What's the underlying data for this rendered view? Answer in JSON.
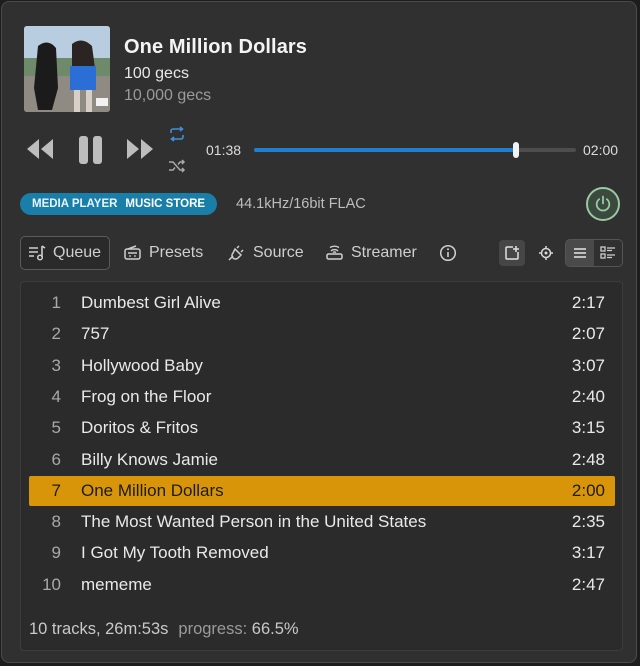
{
  "now_playing": {
    "title": "One Million Dollars",
    "artist": "100 gecs",
    "album": "10,000 gecs",
    "elapsed": "01:38",
    "duration": "02:00",
    "progress_fraction": 0.815
  },
  "source_pill": {
    "media_player": "MEDIA PLAYER",
    "music_store": "MUSIC STORE"
  },
  "audio_format": "44.1kHz/16bit FLAC",
  "tabs": [
    {
      "label": "Queue",
      "icon": "queue-icon"
    },
    {
      "label": "Presets",
      "icon": "radio-icon"
    },
    {
      "label": "Source",
      "icon": "plug-icon"
    },
    {
      "label": "Streamer",
      "icon": "router-icon"
    }
  ],
  "queue": {
    "tracks": [
      {
        "num": "1",
        "title": "Dumbest Girl Alive",
        "duration": "2:17"
      },
      {
        "num": "2",
        "title": "757",
        "duration": "2:07"
      },
      {
        "num": "3",
        "title": "Hollywood Baby",
        "duration": "3:07"
      },
      {
        "num": "4",
        "title": "Frog on the Floor",
        "duration": "2:40"
      },
      {
        "num": "5",
        "title": "Doritos & Fritos",
        "duration": "3:15"
      },
      {
        "num": "6",
        "title": "Billy Knows Jamie",
        "duration": "2:48"
      },
      {
        "num": "7",
        "title": "One Million Dollars",
        "duration": "2:00"
      },
      {
        "num": "8",
        "title": "The Most Wanted Person in the United States",
        "duration": "2:35"
      },
      {
        "num": "9",
        "title": "I Got My Tooth Removed",
        "duration": "3:17"
      },
      {
        "num": "10",
        "title": "mememe",
        "duration": "2:47"
      }
    ],
    "current_index": 6,
    "summary": "10 tracks, 26m:53s",
    "progress_label": "progress:",
    "progress_value": "66.5%"
  },
  "colors": {
    "accent_blue": "#1f7fd1",
    "current_row": "#d9950a",
    "pill": "#1a7fa8",
    "power_ring": "#9cc7a4"
  }
}
